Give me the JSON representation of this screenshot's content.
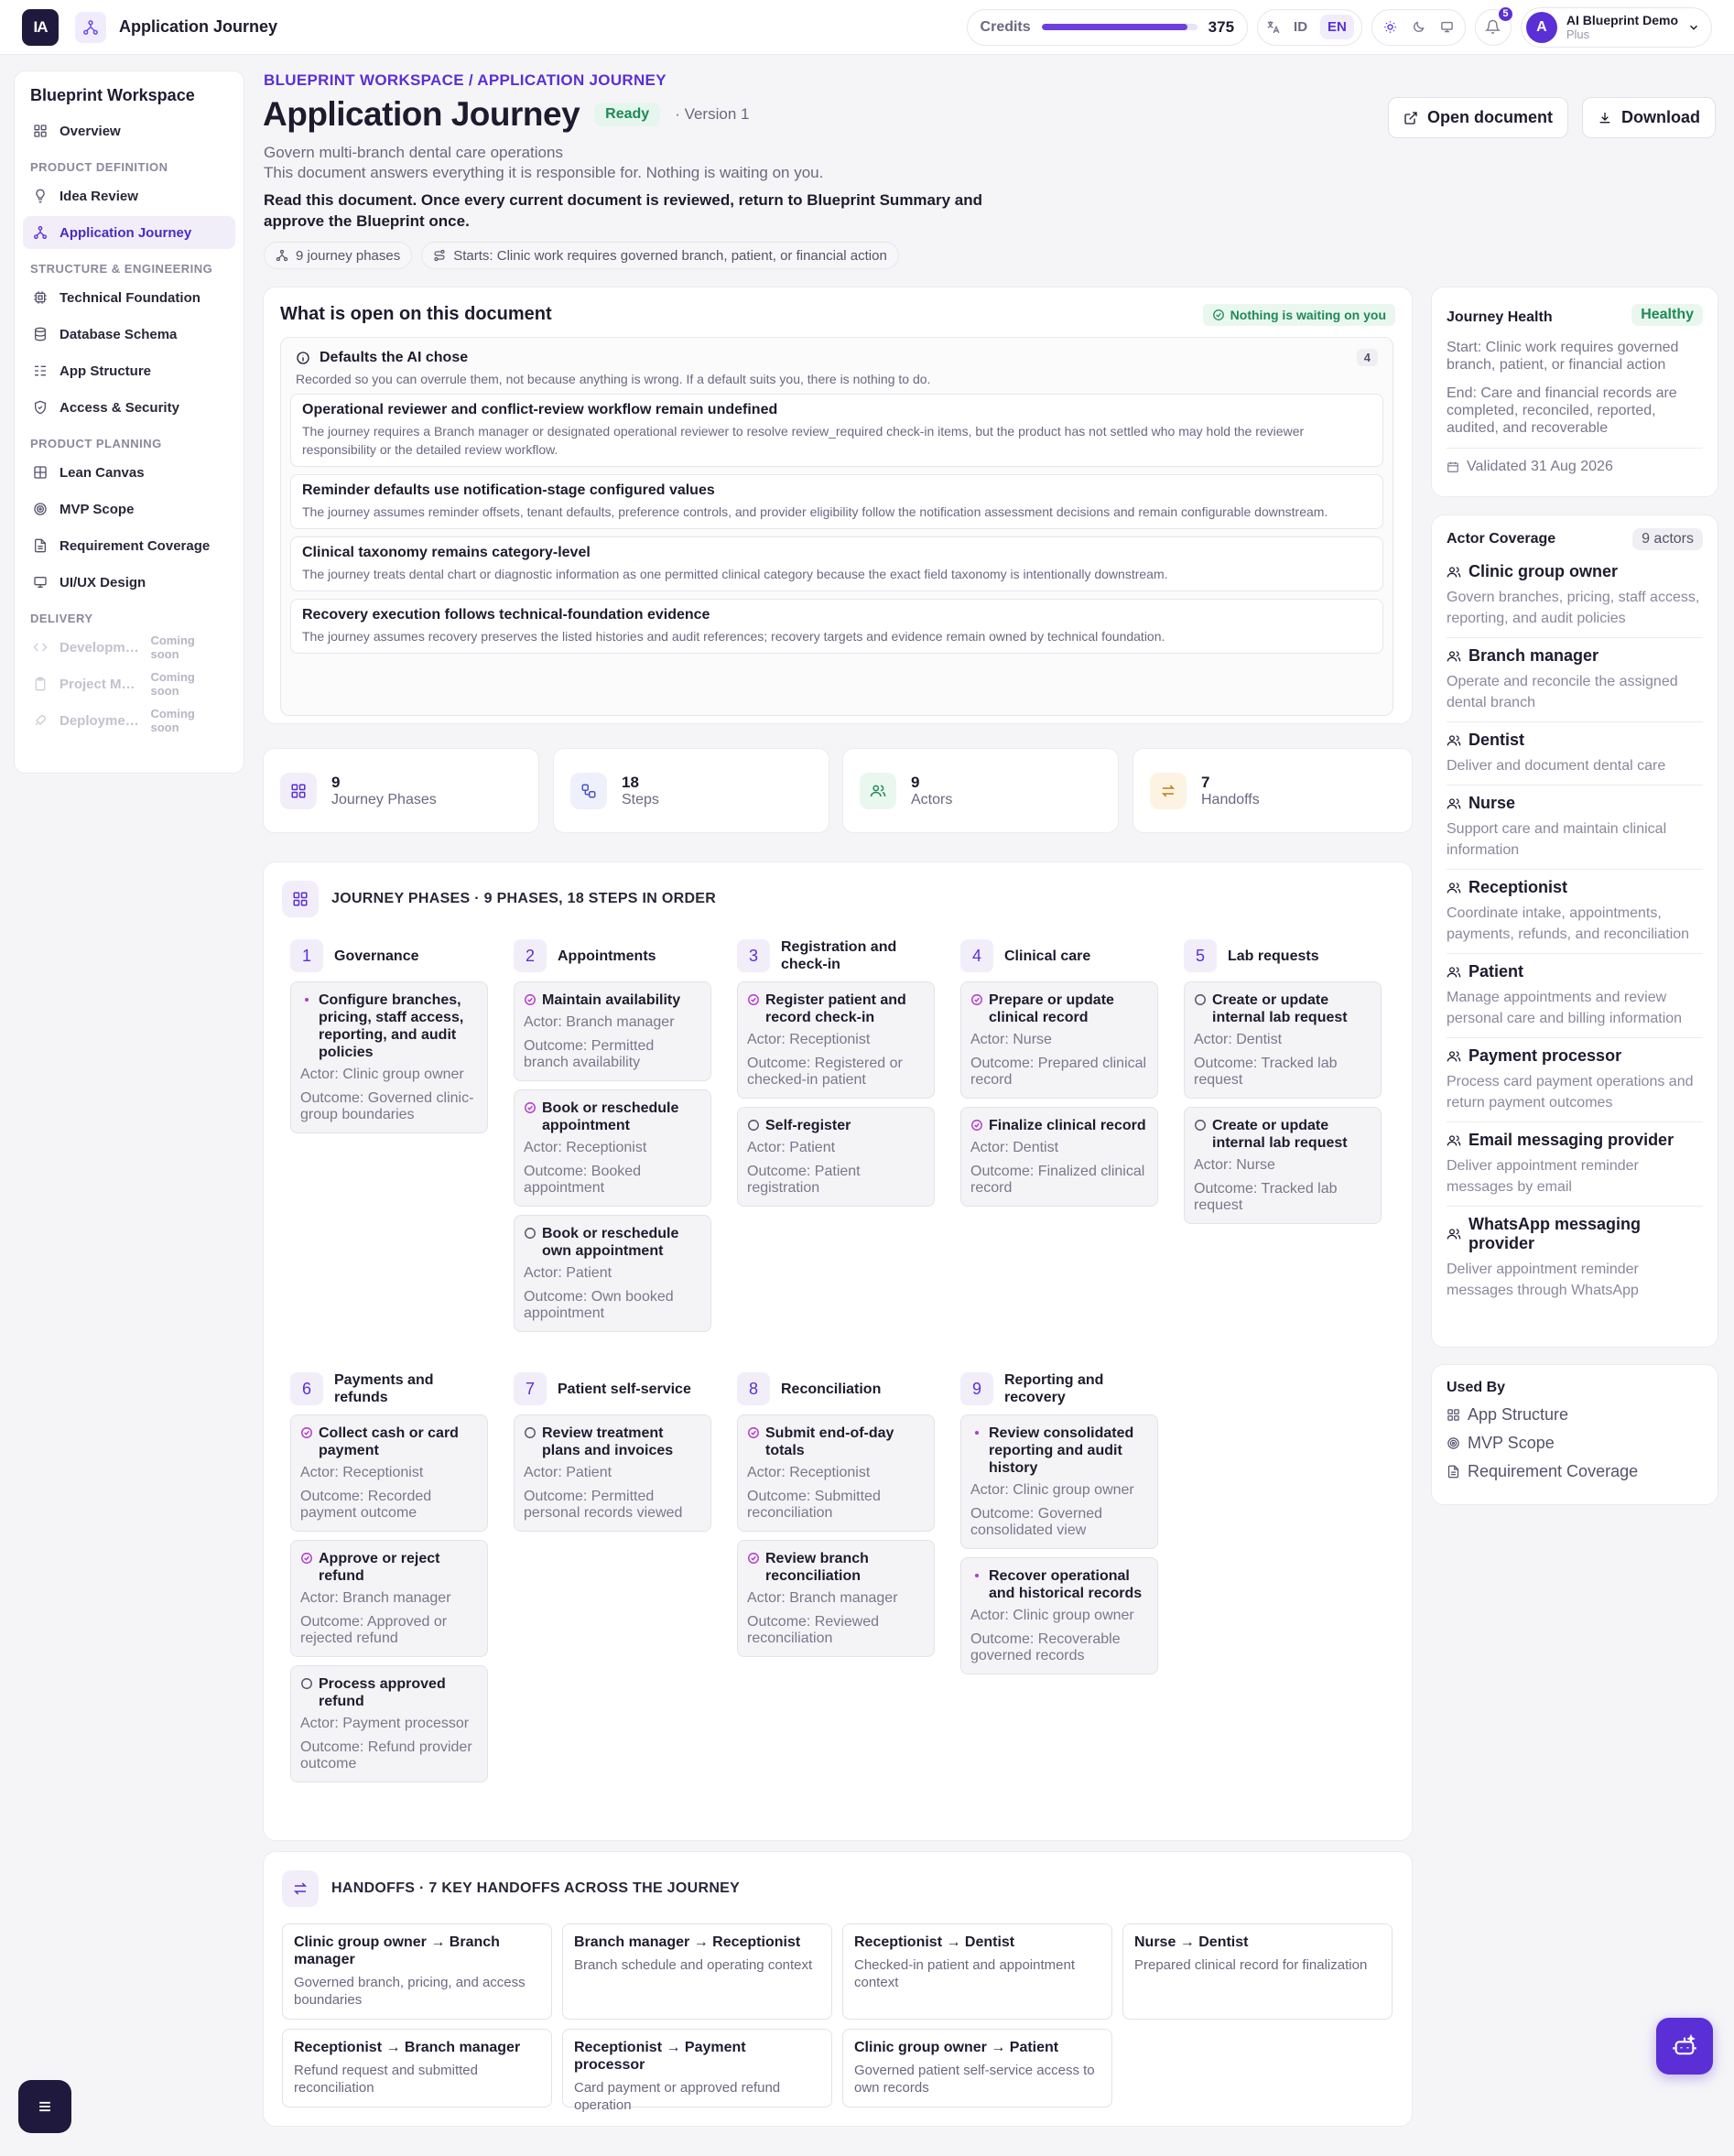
{
  "topbar": {
    "logo": "IA",
    "app_title": "Application Journey",
    "credits_label": "Credits",
    "credits_fill_fraction": 0.94,
    "credits_value": "375",
    "lang_id": "ID",
    "lang_en": "EN",
    "notifications": "5",
    "user_initial": "A",
    "user_name": "AI Blueprint Demo",
    "user_plan": "Plus"
  },
  "sidebar": {
    "title": "Blueprint Workspace",
    "overview": "Overview",
    "sec_product_definition": "PRODUCT DEFINITION",
    "idea_review": "Idea Review",
    "application_journey": "Application Journey",
    "sec_structure": "STRUCTURE & ENGINEERING",
    "technical_foundation": "Technical Foundation",
    "database_schema": "Database Schema",
    "app_structure": "App Structure",
    "access_security": "Access & Security",
    "sec_planning": "PRODUCT PLANNING",
    "lean_canvas": "Lean Canvas",
    "mvp_scope": "MVP Scope",
    "requirement_coverage": "Requirement Coverage",
    "uiux_design": "UI/UX Design",
    "sec_delivery": "DELIVERY",
    "development": "Developm…",
    "project_management": "Project Ma…",
    "deployment": "Deployme…",
    "coming_soon": "Coming soon"
  },
  "header": {
    "breadcrumb": "BLUEPRINT WORKSPACE / APPLICATION JOURNEY",
    "title": "Application Journey",
    "status": "Ready",
    "version": "· Version 1",
    "subtitle": "Govern multi-branch dental care operations",
    "responsibility": "This document answers everything it is responsible for. Nothing is waiting on you.",
    "note": "Read this document. Once every current document is reviewed, return to Blueprint Summary and approve the Blueprint once.",
    "chip_phases": "9 journey phases",
    "chip_start": "Starts: Clinic work requires governed branch, patient, or financial action",
    "open_document": "Open document",
    "download": "Download"
  },
  "open_panel": {
    "title": "What is open on this document",
    "nothing_waiting": "Nothing is waiting on you",
    "defaults_title": "Defaults the AI chose",
    "defaults_count": "4",
    "defaults_sub": "Recorded so you can overrule them, not because anything is wrong. If a default suits you, there is nothing to do.",
    "items": [
      {
        "title": "Operational reviewer and conflict-review workflow remain undefined",
        "desc": "The journey requires a Branch manager or designated operational reviewer to resolve review_required check-in items, but the product has not settled who may hold the reviewer responsibility or the detailed review workflow."
      },
      {
        "title": "Reminder defaults use notification-stage configured values",
        "desc": "The journey assumes reminder offsets, tenant defaults, preference controls, and provider eligibility follow the notification assessment decisions and remain configurable downstream."
      },
      {
        "title": "Clinical taxonomy remains category-level",
        "desc": "The journey treats dental chart or diagnostic information as one permitted clinical category because the exact field taxonomy is intentionally downstream."
      },
      {
        "title": "Recovery execution follows technical-foundation evidence",
        "desc": "The journey assumes recovery preserves the listed histories and audit references; recovery targets and evidence remain owned by technical foundation."
      }
    ]
  },
  "stats": [
    {
      "value": "9",
      "label": "Journey Phases"
    },
    {
      "value": "18",
      "label": "Steps"
    },
    {
      "value": "9",
      "label": "Actors"
    },
    {
      "value": "7",
      "label": "Handoffs"
    }
  ],
  "phases_section": {
    "title": "JOURNEY PHASES · 9 PHASES, 18 STEPS IN ORDER",
    "phases": [
      {
        "num": "1",
        "name": "Governance",
        "steps": [
          {
            "title": "Configure branches, pricing, staff access, reporting, and audit policies",
            "mark": "dot",
            "actor": "Actor: Clinic group owner",
            "outcome": "Outcome: Governed clinic-group boundaries"
          }
        ]
      },
      {
        "num": "2",
        "name": "Appointments",
        "steps": [
          {
            "title": "Maintain availability",
            "mark": "check",
            "actor": "Actor: Branch manager",
            "outcome": "Outcome: Permitted branch availability"
          },
          {
            "title": "Book or reschedule appointment",
            "mark": "check",
            "actor": "Actor: Receptionist",
            "outcome": "Outcome: Booked appointment"
          },
          {
            "title": "Book or reschedule own appointment",
            "mark": "circle",
            "actor": "Actor: Patient",
            "outcome": "Outcome: Own booked appointment"
          }
        ]
      },
      {
        "num": "3",
        "name": "Registration and check-in",
        "steps": [
          {
            "title": "Register patient and record check-in",
            "mark": "check",
            "actor": "Actor: Receptionist",
            "outcome": "Outcome: Registered or checked-in patient"
          },
          {
            "title": "Self-register",
            "mark": "circle",
            "actor": "Actor: Patient",
            "outcome": "Outcome: Patient registration"
          }
        ]
      },
      {
        "num": "4",
        "name": "Clinical care",
        "steps": [
          {
            "title": "Prepare or update clinical record",
            "mark": "check",
            "actor": "Actor: Nurse",
            "outcome": "Outcome: Prepared clinical record"
          },
          {
            "title": "Finalize clinical record",
            "mark": "check",
            "actor": "Actor: Dentist",
            "outcome": "Outcome: Finalized clinical record"
          }
        ]
      },
      {
        "num": "5",
        "name": "Lab requests",
        "steps": [
          {
            "title": "Create or update internal lab request",
            "mark": "circle",
            "actor": "Actor: Dentist",
            "outcome": "Outcome: Tracked lab request"
          },
          {
            "title": "Create or update internal lab request",
            "mark": "circle",
            "actor": "Actor: Nurse",
            "outcome": "Outcome: Tracked lab request"
          }
        ]
      },
      {
        "num": "6",
        "name": "Payments and refunds",
        "steps": [
          {
            "title": "Collect cash or card payment",
            "mark": "check",
            "actor": "Actor: Receptionist",
            "outcome": "Outcome: Recorded payment outcome"
          },
          {
            "title": "Approve or reject refund",
            "mark": "check",
            "actor": "Actor: Branch manager",
            "outcome": "Outcome: Approved or rejected refund"
          },
          {
            "title": "Process approved refund",
            "mark": "circle",
            "actor": "Actor: Payment processor",
            "outcome": "Outcome: Refund provider outcome"
          }
        ]
      },
      {
        "num": "7",
        "name": "Patient self-service",
        "steps": [
          {
            "title": "Review treatment plans and invoices",
            "mark": "circle",
            "actor": "Actor: Patient",
            "outcome": "Outcome: Permitted personal records viewed"
          }
        ]
      },
      {
        "num": "8",
        "name": "Reconciliation",
        "steps": [
          {
            "title": "Submit end-of-day totals",
            "mark": "check",
            "actor": "Actor: Receptionist",
            "outcome": "Outcome: Submitted reconciliation"
          },
          {
            "title": "Review branch reconciliation",
            "mark": "check",
            "actor": "Actor: Branch manager",
            "outcome": "Outcome: Reviewed reconciliation"
          }
        ]
      },
      {
        "num": "9",
        "name": "Reporting and recovery",
        "steps": [
          {
            "title": "Review consolidated reporting and audit history",
            "mark": "dot",
            "actor": "Actor: Clinic group owner",
            "outcome": "Outcome: Governed consolidated view"
          },
          {
            "title": "Recover operational and historical records",
            "mark": "dot",
            "actor": "Actor: Clinic group owner",
            "outcome": "Outcome: Recoverable governed records"
          }
        ]
      }
    ]
  },
  "handoffs_section": {
    "title": "HANDOFFS · 7 KEY HANDOFFS ACROSS THE JOURNEY",
    "items": [
      {
        "title": "Clinic group owner → Branch manager",
        "desc": "Governed branch, pricing, and access boundaries"
      },
      {
        "title": "Branch manager → Receptionist",
        "desc": "Branch schedule and operating context"
      },
      {
        "title": "Receptionist → Dentist",
        "desc": "Checked-in patient and appointment context"
      },
      {
        "title": "Nurse → Dentist",
        "desc": "Prepared clinical record for finalization"
      },
      {
        "title": "Receptionist → Branch manager",
        "desc": "Refund request and submitted reconciliation"
      },
      {
        "title": "Receptionist → Payment processor",
        "desc": "Card payment or approved refund operation"
      },
      {
        "title": "Clinic group owner → Patient",
        "desc": "Governed patient self-service access to own records"
      }
    ]
  },
  "journey_health": {
    "title": "Journey Health",
    "status": "Healthy",
    "start": "Start: Clinic work requires governed branch, patient, or financial action",
    "end": "End: Care and financial records are completed, reconciled, reported, audited, and recoverable",
    "validated": "Validated 31 Aug 2026"
  },
  "actor_coverage": {
    "title": "Actor Coverage",
    "count": "9 actors",
    "actors": [
      {
        "name": "Clinic group owner",
        "desc": "Govern branches, pricing, staff access, reporting, and audit policies"
      },
      {
        "name": "Branch manager",
        "desc": "Operate and reconcile the assigned dental branch"
      },
      {
        "name": "Dentist",
        "desc": "Deliver and document dental care"
      },
      {
        "name": "Nurse",
        "desc": "Support care and maintain clinical information"
      },
      {
        "name": "Receptionist",
        "desc": "Coordinate intake, appointments, payments, refunds, and reconciliation"
      },
      {
        "name": "Patient",
        "desc": "Manage appointments and review personal care and billing information"
      },
      {
        "name": "Payment processor",
        "desc": "Process card payment operations and return payment outcomes"
      },
      {
        "name": "Email messaging provider",
        "desc": "Deliver appointment reminder messages by email"
      },
      {
        "name": "WhatsApp messaging provider",
        "desc": "Deliver appointment reminder messages through WhatsApp"
      }
    ]
  },
  "used_by": {
    "title": "Used By",
    "items": [
      "App Structure",
      "MVP Scope",
      "Requirement Coverage"
    ]
  },
  "colors": {
    "accent": "#5b2fd6",
    "success": "#1f8a55",
    "step_mark": "#b33ac8"
  }
}
